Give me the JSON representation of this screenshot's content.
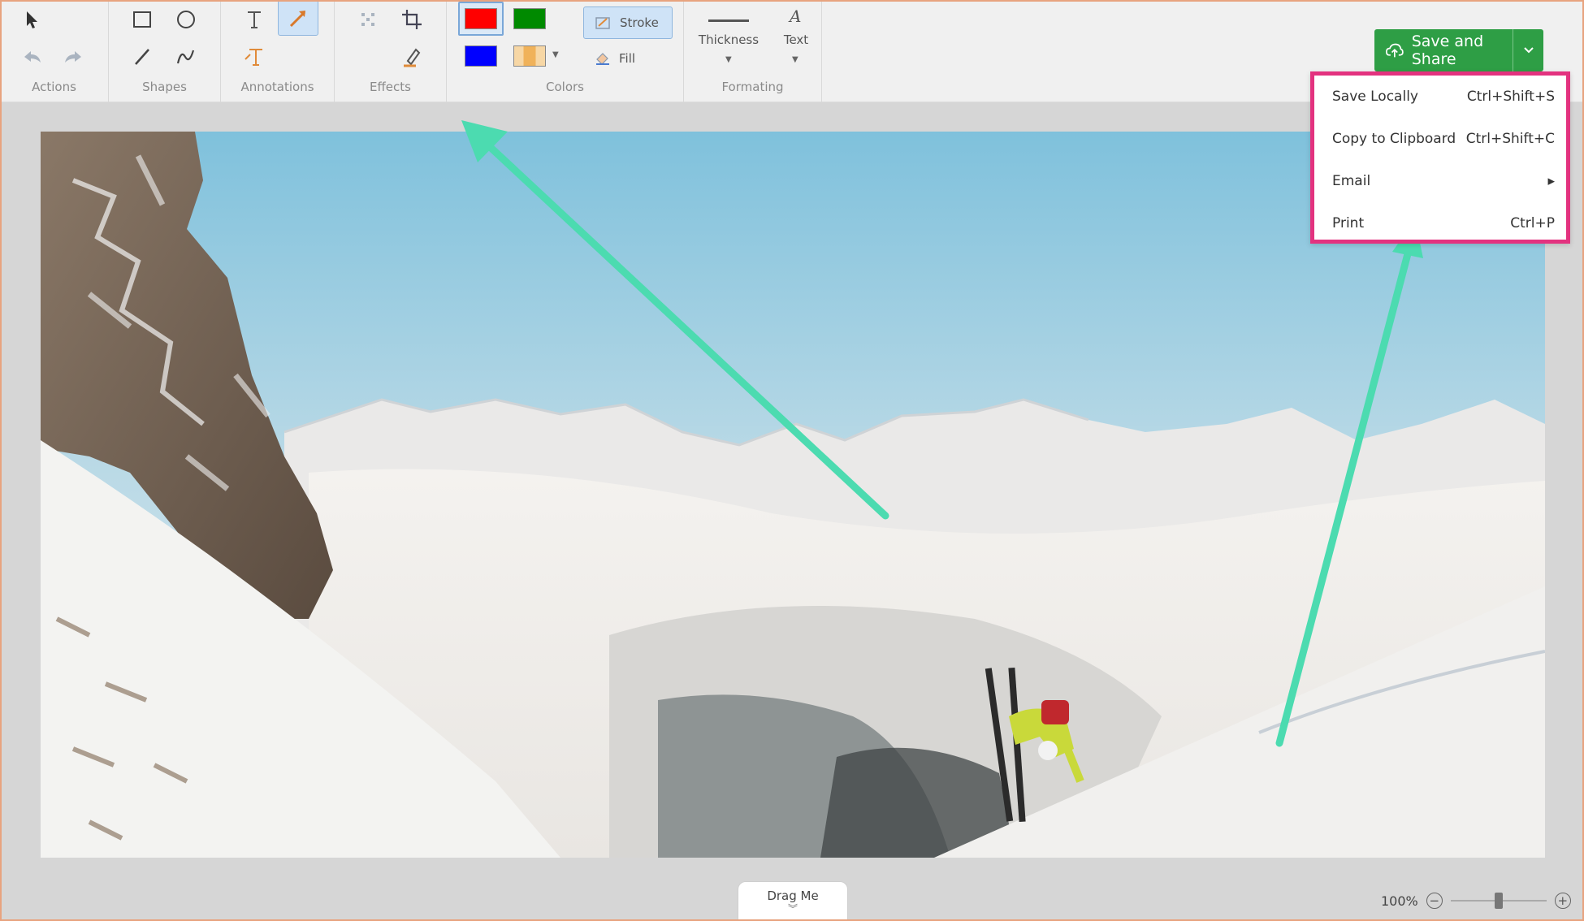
{
  "ribbon": {
    "groups": {
      "actions": "Actions",
      "shapes": "Shapes",
      "annotations": "Annotations",
      "effects": "Effects",
      "colors": "Colors",
      "formatting": "Formating"
    },
    "colors": {
      "swatches": [
        "#ff0000",
        "#008a00",
        "#0000ff",
        "#f0b25a"
      ],
      "stroke_label": "Stroke",
      "fill_label": "Fill"
    },
    "formatting": {
      "thickness_label": "Thickness",
      "text_label": "Text"
    },
    "icons": [
      "cursor-icon",
      "undo-icon",
      "redo-icon",
      "rectangle-icon",
      "ellipse-icon",
      "line-icon",
      "freehand-icon",
      "text-icon",
      "arrow-icon",
      "text-outline-icon",
      "blur-icon",
      "crop-icon",
      "highlighter-icon"
    ]
  },
  "save": {
    "label": "Save and Share",
    "accent": "#2e9e45"
  },
  "menu": {
    "border_color": "#e3327f",
    "items": [
      {
        "label": "Save Locally",
        "shortcut": "Ctrl+Shift+S"
      },
      {
        "label": "Copy to Clipboard",
        "shortcut": "Ctrl+Shift+C"
      },
      {
        "label": "Email",
        "shortcut": "▸"
      },
      {
        "label": "Print",
        "shortcut": "Ctrl+P"
      }
    ]
  },
  "annotation_color": "#4cdbb0",
  "bottom": {
    "drag_label": "Drag Me",
    "zoom_label": "100%",
    "zoom_level": 0.5
  }
}
